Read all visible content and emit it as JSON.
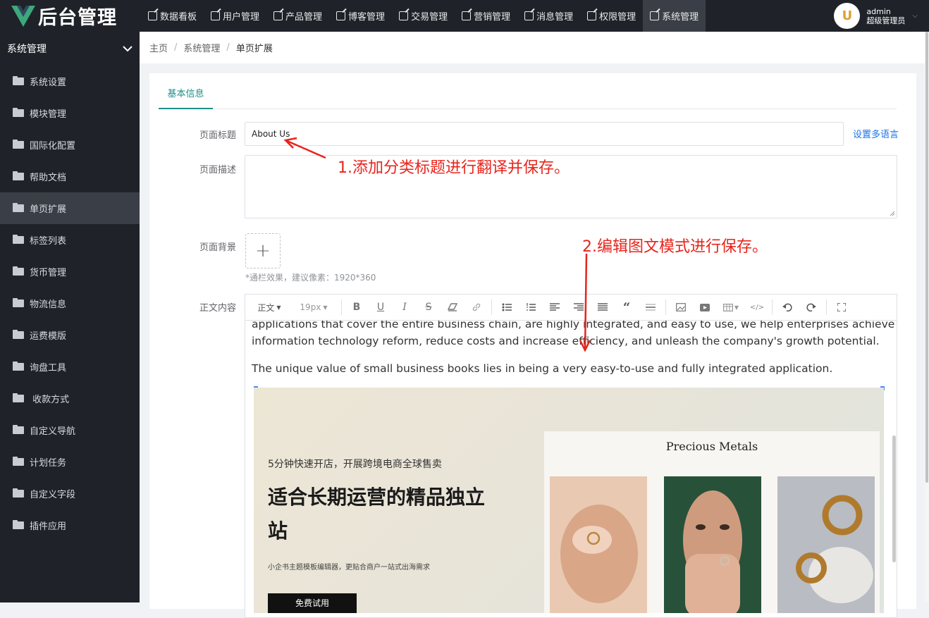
{
  "app": {
    "title": "后台管理"
  },
  "nav": [
    {
      "label": "数据看板"
    },
    {
      "label": "用户管理"
    },
    {
      "label": "产品管理"
    },
    {
      "label": "博客管理"
    },
    {
      "label": "交易管理"
    },
    {
      "label": "营销管理"
    },
    {
      "label": "消息管理"
    },
    {
      "label": "权限管理"
    },
    {
      "label": "系统管理",
      "active": true
    }
  ],
  "user": {
    "name": "admin",
    "role": "超级管理员",
    "avatar_letter": "U"
  },
  "sidebar": {
    "section": "系统管理",
    "items": [
      {
        "label": "系统设置"
      },
      {
        "label": "模块管理"
      },
      {
        "label": "国际化配置"
      },
      {
        "label": "帮助文档"
      },
      {
        "label": "单页扩展",
        "active": true
      },
      {
        "label": "标签列表"
      },
      {
        "label": "货币管理"
      },
      {
        "label": "物流信息"
      },
      {
        "label": "运费模版"
      },
      {
        "label": "询盘工具"
      },
      {
        "label": " 收款方式"
      },
      {
        "label": "自定义导航"
      },
      {
        "label": "计划任务"
      },
      {
        "label": "自定义字段"
      },
      {
        "label": "插件应用"
      }
    ]
  },
  "breadcrumb": [
    "主页",
    "系统管理",
    "单页扩展"
  ],
  "tabs": [
    {
      "label": "基本信息"
    }
  ],
  "form": {
    "title_label": "页面标题",
    "title_value": "About Us",
    "multilang_link": "设置多语言",
    "desc_label": "页面描述",
    "bg_label": "页面背景",
    "bg_hint": "*通栏效果，建议像素：1920*360",
    "content_label": "正文内容"
  },
  "editor": {
    "paragraph_style": "正文",
    "font_size": "19px",
    "text_line1": "applications that cover the entire business chain, are highly integrated, and easy to use, we help enterprises achieve",
    "text_line2": "information technology reform, reduce costs and increase efficiency, and unleash the company's growth potential.",
    "text_line3": "The unique value of small business books lies in being a very easy-to-use and fully integrated application."
  },
  "banner": {
    "small_title": "5分钟快速开店，开展跨境电商全球售卖",
    "big_title": "适合长期运营的精品独立站",
    "subtitle": "小企书主题模板编辑器，更贴合商户一站式出海需求",
    "button": "免费试用",
    "panel_title": "Precious Metals"
  },
  "annotations": {
    "note1": "1.添加分类标题进行翻译并保存。",
    "note2": "2.编辑图文模式进行保存。"
  },
  "colors": {
    "accent": "#1f8f8a",
    "topbar": "#1f2329",
    "annotation": "#e8241c",
    "link": "#1a73e8"
  }
}
